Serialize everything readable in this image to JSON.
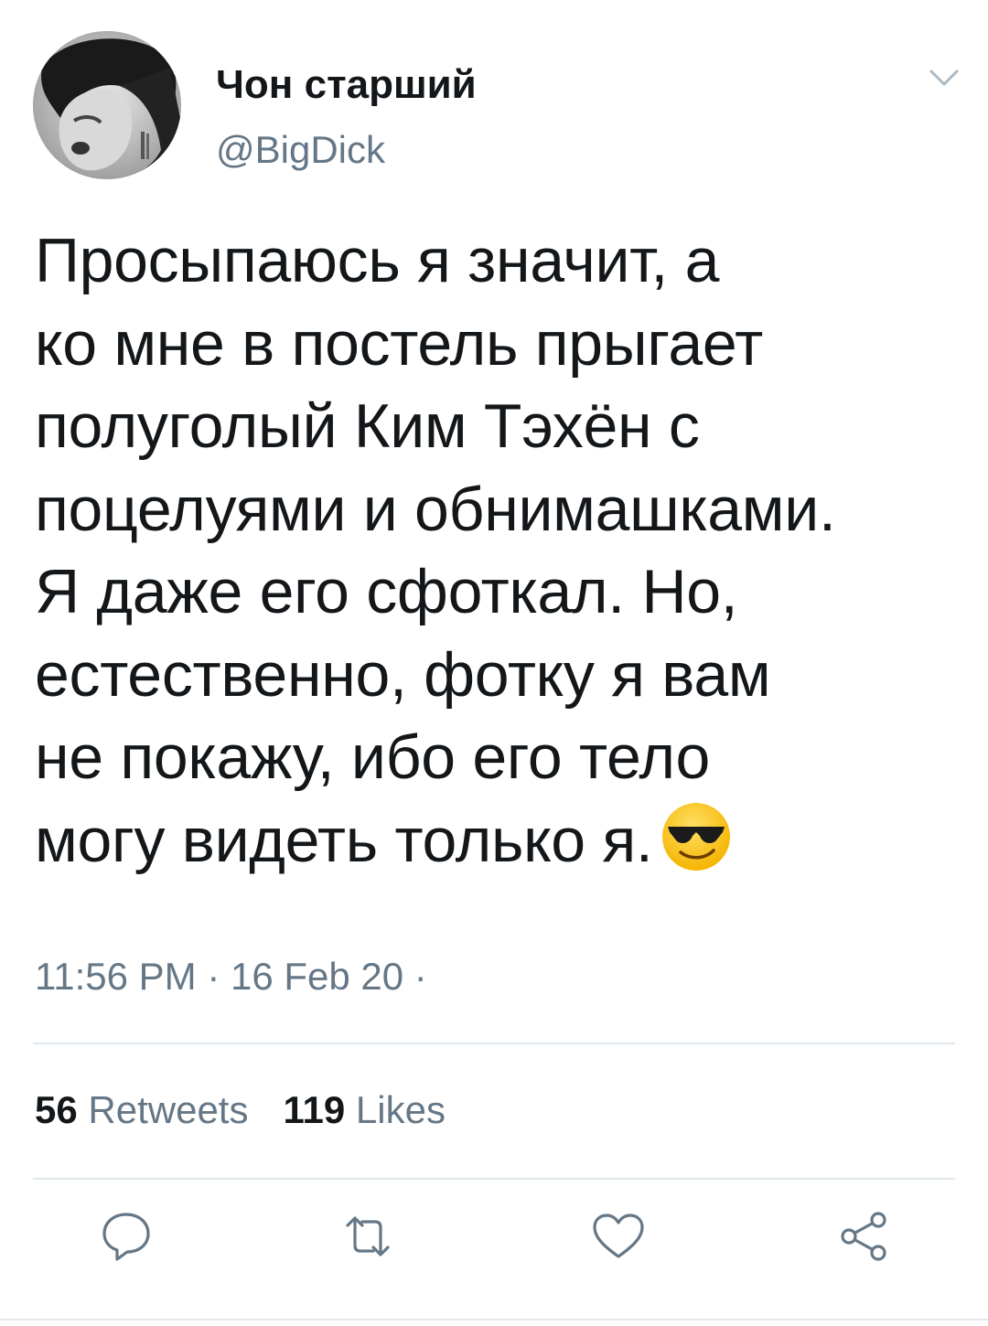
{
  "user": {
    "display_name": "Чон старший",
    "handle": "@BigDick",
    "avatar": "avatar-photo"
  },
  "menu_icon": "chevron-down-icon",
  "tweet": {
    "text": "Просыпаюсь я значит, а\nко мне в постель прыгает\nполуголый Ким Тэхён с\nпоцелуями и обнимашками.\nЯ даже его сфоткал. Но,\nестественно, фотку я вам\nне покажу, ибо его тело\nмогу видеть только я.",
    "emoji": "smiling-face-with-sunglasses",
    "timestamp": "11:56 PM · 16 Feb 20 ·"
  },
  "stats": {
    "retweets_count": "56",
    "retweets_label": "Retweets",
    "likes_count": "119",
    "likes_label": "Likes"
  },
  "actions": [
    {
      "icon": "reply-icon"
    },
    {
      "icon": "retweet-icon"
    },
    {
      "icon": "like-icon"
    },
    {
      "icon": "share-icon"
    }
  ],
  "colors": {
    "text_primary": "#14171a",
    "text_secondary": "#657786",
    "divider": "#e1e8ed",
    "icon": "#657786"
  }
}
